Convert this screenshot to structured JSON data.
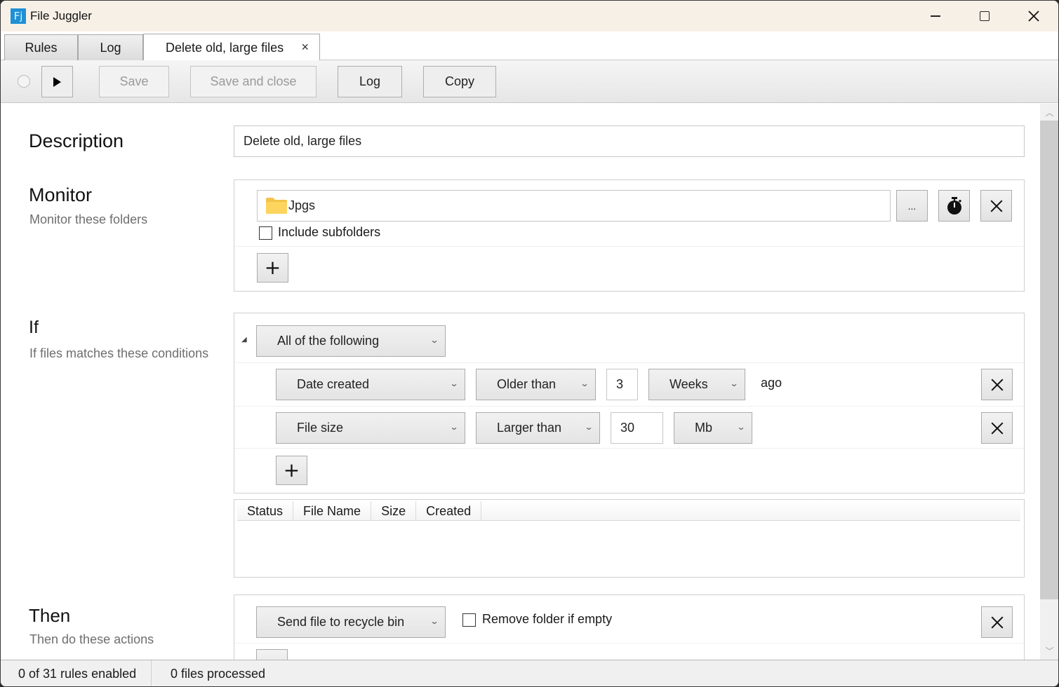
{
  "window": {
    "app_icon_text": "Fj",
    "title": "File Juggler",
    "controls": {
      "minimize": "minimize",
      "maximize": "maximize",
      "close": "close"
    }
  },
  "tabs": [
    {
      "label": "Rules",
      "active": false
    },
    {
      "label": "Log",
      "active": false
    },
    {
      "label": "Delete old, large files",
      "active": true,
      "close_glyph": "×"
    }
  ],
  "settings_icon": "gear-icon",
  "toolbar": {
    "enabled_toggle": "radio-off",
    "run_icon": "play-icon",
    "save_label": "Save",
    "save_and_close_label": "Save and close",
    "log_label": "Log",
    "copy_label": "Copy"
  },
  "description": {
    "title": "Description",
    "value": "Delete old, large files"
  },
  "monitor": {
    "title": "Monitor",
    "subtitle": "Monitor these folders",
    "folders": [
      {
        "icon": "folder-icon",
        "path": "Jpgs",
        "include_subfolders": false
      }
    ],
    "include_subfolders_label": "Include subfolders",
    "browse_label": "...",
    "schedule_icon": "stopwatch-icon",
    "remove_icon": "close-icon",
    "add_label": "+"
  },
  "if": {
    "title": "If",
    "subtitle": "If files matches these conditions",
    "collapse_glyph": "◢",
    "group_mode": "All of the following",
    "conditions": [
      {
        "property": "Date created",
        "operator": "Older than",
        "value": "3",
        "unit": "Weeks",
        "suffix": "ago"
      },
      {
        "property": "File size",
        "operator": "Larger than",
        "value": "30",
        "unit": "Mb",
        "suffix": ""
      }
    ],
    "add_label": "+",
    "chevron": "⌄"
  },
  "preview_table": {
    "columns": [
      "Status",
      "File Name",
      "Size",
      "Created"
    ],
    "rows": []
  },
  "then": {
    "title": "Then",
    "subtitle": "Then do these actions",
    "actions": [
      {
        "action": "Send file to recycle bin",
        "remove_folder_if_empty": false
      }
    ],
    "remove_folder_label": "Remove folder if empty"
  },
  "statusbar": {
    "rules_enabled": "0 of 31 rules enabled",
    "files_processed": "0 files processed"
  },
  "scrollbar": {
    "up": "︿",
    "down": "﹀",
    "position_fraction": 0.0
  }
}
